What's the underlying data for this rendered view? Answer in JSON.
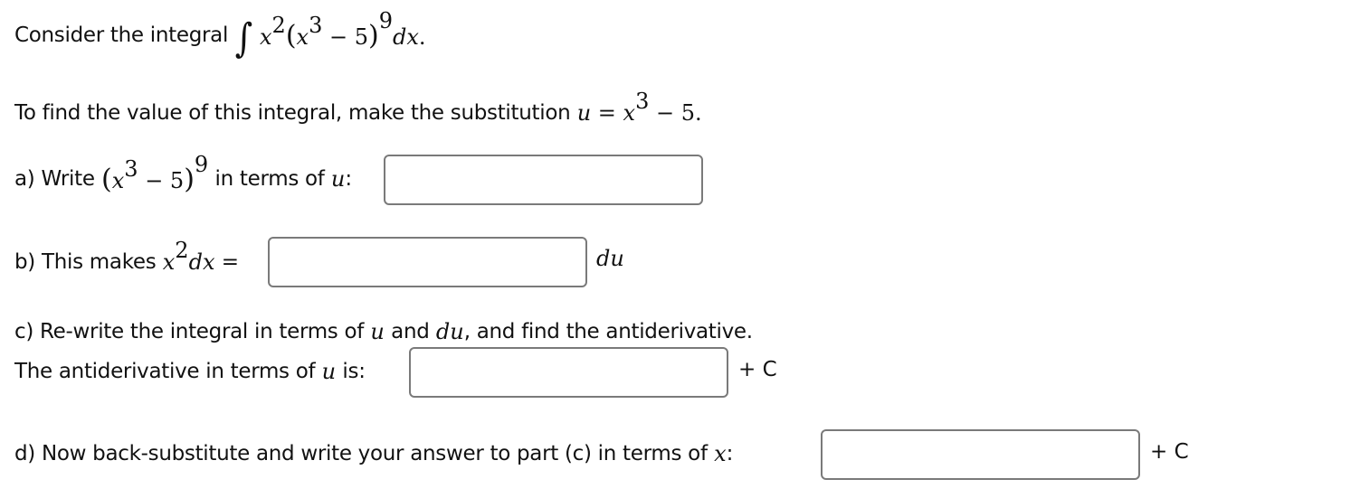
{
  "intro": {
    "prefix": "Consider the integral",
    "integral": {
      "integrand_a": "x",
      "exp_a": "2",
      "inner_var": "x",
      "inner_exp": "3",
      "inner_rest": " − 5",
      "outer_exp": "9",
      "differential": "dx",
      "end": "."
    }
  },
  "substitution": {
    "text": "To find the value of this integral, make the substitution",
    "u": "u",
    "eq": " = ",
    "x": "x",
    "exp": "3",
    "rest": " − 5."
  },
  "part_a": {
    "prefix": "a) Write",
    "expr_var": "x",
    "expr_exp": "3",
    "expr_rest": " − 5",
    "outer_exp": "9",
    "suffix": "in terms of",
    "u": "u",
    "colon": ":",
    "input_value": ""
  },
  "part_b": {
    "prefix": "b) This makes",
    "x": "x",
    "exp": "2",
    "dx": "dx",
    "eq": "=",
    "input_value": "",
    "after": "du"
  },
  "part_c": {
    "line1_prefix": "c) Re-write the integral in terms of",
    "u": "u",
    "and": "and",
    "du": "du",
    "line1_suffix": ", and find the antiderivative.",
    "line2_prefix": "The antiderivative in terms of",
    "u2": "u",
    "line2_suffix": "is:",
    "input_value": "",
    "after": "+ C"
  },
  "part_d": {
    "prefix": "d) Now back-substitute and write your answer to part (c) in terms of",
    "x": "x",
    "colon": ":",
    "input_value": "",
    "after": "+ C"
  },
  "colors": {
    "text": "#111111",
    "input_border": "#7a7a7a",
    "background": "#ffffff"
  }
}
